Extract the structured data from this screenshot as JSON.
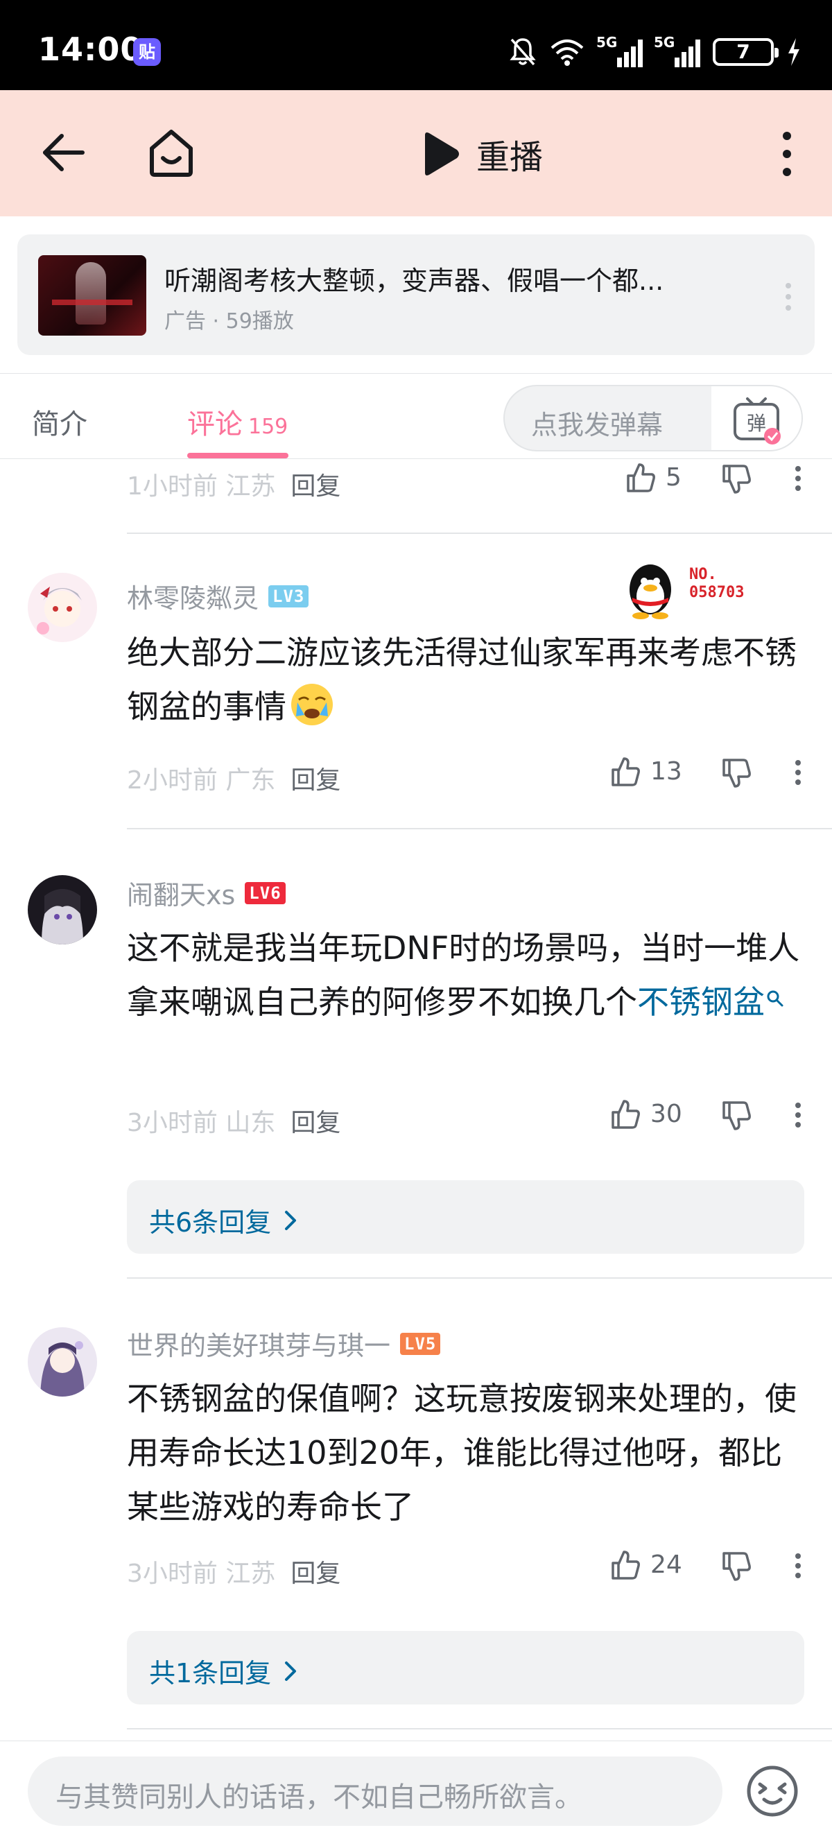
{
  "status_bar": {
    "time": "14:00",
    "app_badge": "贴",
    "network_1": "5G",
    "network_2": "5G",
    "battery": "7"
  },
  "nav": {
    "back_icon": "back-arrow-icon",
    "home_icon": "home-icon",
    "replay_label": "重播",
    "more_icon": "more-vertical-icon"
  },
  "ad": {
    "title": "听潮阁考核大整顿，变声器、假唱一个都...",
    "subtitle": "广告 · 59播放"
  },
  "tabs": {
    "intro": "简介",
    "comments": "评论",
    "comments_count": "159",
    "danmaku_placeholder": "点我发弹幕",
    "danmaku_icon_label": "弹"
  },
  "comments": [
    {
      "partial": true,
      "time": "1小时前",
      "location": "江苏",
      "reply": "回复",
      "likes": "5"
    },
    {
      "username": "林零陵粼灵",
      "level": "LV3",
      "text": "绝大部分二游应该先活得过仙家军再来考虑不锈钢盆的事情",
      "emoji": "sob-emoji",
      "time": "2小时前",
      "location": "广东",
      "reply": "回复",
      "likes": "13",
      "fan_badge": "NO.\n058703"
    },
    {
      "username": "闹翻天xs",
      "level": "LV6",
      "text": "这不就是我当年玩DNF时的场景吗，当时一堆人拿来嘲讽自己养的阿修罗不如换几个",
      "link": "不锈钢盆",
      "time": "3小时前",
      "location": "山东",
      "reply": "回复",
      "likes": "30",
      "replies_label": "共6条回复"
    },
    {
      "username": "世界的美好琪芽与琪一",
      "level": "LV5",
      "text": "不锈钢盆的保值啊？这玩意按废钢来处理的，使用寿命长达10到20年，谁能比得过他呀，都比某些游戏的寿命长了",
      "time": "3小时前",
      "location": "江苏",
      "reply": "回复",
      "likes": "24",
      "replies_label": "共1条回复"
    }
  ],
  "bottom": {
    "placeholder": "与其赞同别人的话语，不如自己畅所欲言。"
  },
  "colors": {
    "accent": "#fb7299",
    "link": "#00699d",
    "nav_bg": "#fce0d9"
  }
}
